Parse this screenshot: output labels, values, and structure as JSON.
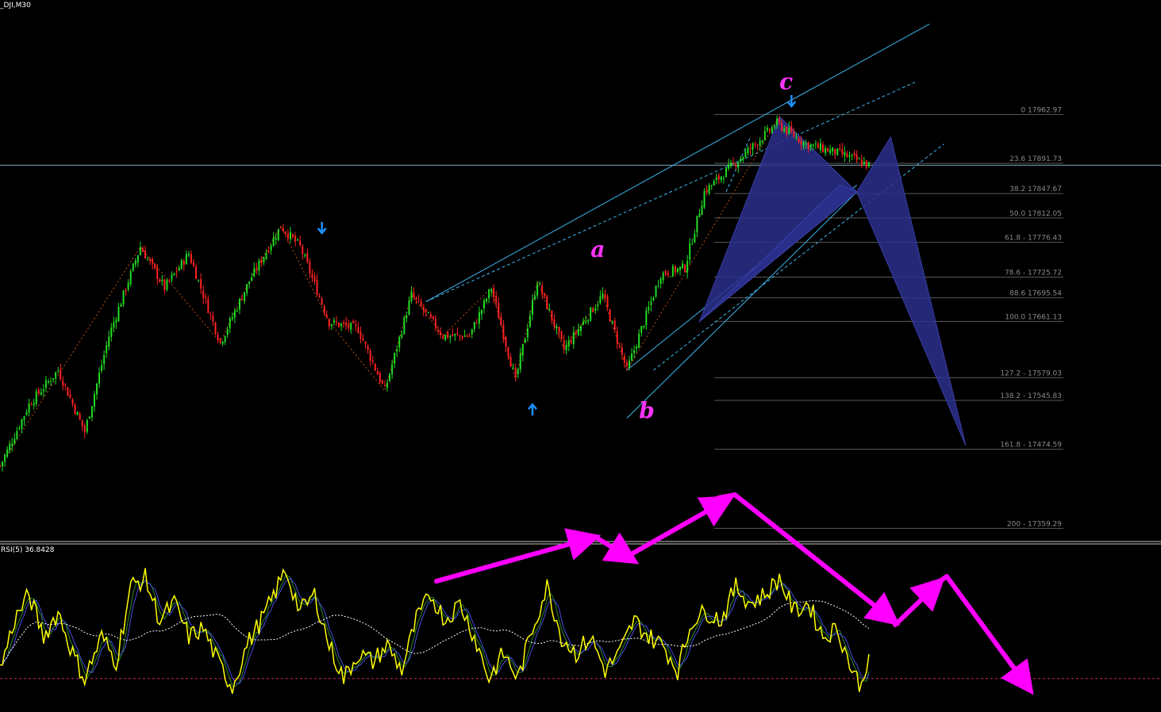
{
  "header": {
    "symbol_label": "_DJI,M30",
    "rsi_label": "RSI(5) 36.8428"
  },
  "colors": {
    "background": "#000000",
    "bull": "#22dd22",
    "bear": "#ff2222",
    "fib_line": "#5a5a5a",
    "trend": "#3fb6f0",
    "pattern_fill": "#2a2f8c",
    "wave_label": "#ff33ff",
    "rsi_line": "#ffff00",
    "rsi_ma": "#ffffff",
    "rsi_level": "#cc2266",
    "arrow": "#1e90ff"
  },
  "chart_data": [
    {
      "type": "candlestick",
      "symbol": "_DJI",
      "timeframe": "M30",
      "price_range": [
        17340,
        18130
      ],
      "current_price": 17889,
      "fib_levels": [
        {
          "level": "0",
          "price": 17962.97,
          "label": "0 17962.97"
        },
        {
          "level": "23.6",
          "price": 17891.73,
          "label": "23.6 17891.73"
        },
        {
          "level": "38.2",
          "price": 17847.67,
          "label": "38.2 17847.67"
        },
        {
          "level": "50.0",
          "price": 17812.05,
          "label": "50.0 17812.05"
        },
        {
          "level": "61.8",
          "price": 17776.43,
          "label": "61.8 - 17776.43"
        },
        {
          "level": "78.6",
          "price": 17725.72,
          "label": "78.6 - 17725.72"
        },
        {
          "level": "88.6",
          "price": 17695.54,
          "label": "88.6 17695.54"
        },
        {
          "level": "100.0",
          "price": 17661.13,
          "label": "100.0 17661.13"
        },
        {
          "level": "127.2",
          "price": 17579.03,
          "label": "127.2 - 17579.03"
        },
        {
          "level": "138.2",
          "price": 17545.83,
          "label": "138.2 - 17545.83"
        },
        {
          "level": "161.8",
          "price": 17474.59,
          "label": "161.8 -  17474.59"
        },
        {
          "level": "200",
          "price": 17359.29,
          "label": "200 - 17359.29"
        }
      ],
      "waypoints": [
        {
          "i": 0,
          "p": 17450
        },
        {
          "i": 12,
          "p": 17540
        },
        {
          "i": 24,
          "p": 17590
        },
        {
          "i": 35,
          "p": 17500
        },
        {
          "i": 45,
          "p": 17640
        },
        {
          "i": 58,
          "p": 17770
        },
        {
          "i": 68,
          "p": 17710
        },
        {
          "i": 78,
          "p": 17760
        },
        {
          "i": 91,
          "p": 17630
        },
        {
          "i": 103,
          "p": 17720
        },
        {
          "i": 116,
          "p": 17800
        },
        {
          "i": 124,
          "p": 17770
        },
        {
          "i": 136,
          "p": 17660
        },
        {
          "i": 148,
          "p": 17650
        },
        {
          "i": 159,
          "p": 17560
        },
        {
          "i": 170,
          "p": 17700
        },
        {
          "i": 183,
          "p": 17640
        },
        {
          "i": 194,
          "p": 17640
        },
        {
          "i": 203,
          "p": 17710
        },
        {
          "i": 213,
          "p": 17575
        },
        {
          "i": 222,
          "p": 17720
        },
        {
          "i": 233,
          "p": 17620
        },
        {
          "i": 249,
          "p": 17700
        },
        {
          "i": 259,
          "p": 17590
        },
        {
          "i": 273,
          "p": 17730
        },
        {
          "i": 283,
          "p": 17740
        },
        {
          "i": 291,
          "p": 17850
        },
        {
          "i": 306,
          "p": 17900
        },
        {
          "i": 321,
          "p": 17950
        },
        {
          "i": 333,
          "p": 17920
        },
        {
          "i": 348,
          "p": 17905
        },
        {
          "i": 359,
          "p": 17889
        }
      ],
      "wave_labels": [
        {
          "text": "a",
          "i": 244,
          "p": 17755
        },
        {
          "text": "b",
          "i": 264,
          "p": 17520
        },
        {
          "text": "c",
          "i": 322,
          "p": 18000
        }
      ],
      "pattern": {
        "name": "harmonic",
        "points": [
          {
            "i": 289,
            "p": 17661
          },
          {
            "i": 322,
            "p": 17960
          },
          {
            "i": 354,
            "p": 17850
          },
          {
            "i": 368,
            "p": 17930
          },
          {
            "i": 399,
            "p": 17480
          }
        ]
      }
    },
    {
      "type": "line",
      "indicator": "RSI",
      "period": 5,
      "current_value": 36.8428,
      "ylim": [
        0,
        100
      ],
      "level": 20,
      "waypoints": [
        {
          "i": 0,
          "v": 25
        },
        {
          "i": 6,
          "v": 55
        },
        {
          "i": 12,
          "v": 70
        },
        {
          "i": 18,
          "v": 45
        },
        {
          "i": 24,
          "v": 60
        },
        {
          "i": 30,
          "v": 35
        },
        {
          "i": 35,
          "v": 20
        },
        {
          "i": 42,
          "v": 45
        },
        {
          "i": 48,
          "v": 30
        },
        {
          "i": 54,
          "v": 75
        },
        {
          "i": 60,
          "v": 80
        },
        {
          "i": 66,
          "v": 55
        },
        {
          "i": 72,
          "v": 65
        },
        {
          "i": 78,
          "v": 45
        },
        {
          "i": 84,
          "v": 50
        },
        {
          "i": 90,
          "v": 30
        },
        {
          "i": 96,
          "v": 15
        },
        {
          "i": 102,
          "v": 40
        },
        {
          "i": 110,
          "v": 60
        },
        {
          "i": 118,
          "v": 85
        },
        {
          "i": 124,
          "v": 60
        },
        {
          "i": 130,
          "v": 70
        },
        {
          "i": 136,
          "v": 40
        },
        {
          "i": 142,
          "v": 20
        },
        {
          "i": 148,
          "v": 35
        },
        {
          "i": 154,
          "v": 30
        },
        {
          "i": 160,
          "v": 40
        },
        {
          "i": 166,
          "v": 25
        },
        {
          "i": 172,
          "v": 55
        },
        {
          "i": 178,
          "v": 70
        },
        {
          "i": 184,
          "v": 55
        },
        {
          "i": 190,
          "v": 65
        },
        {
          "i": 196,
          "v": 45
        },
        {
          "i": 202,
          "v": 20
        },
        {
          "i": 208,
          "v": 35
        },
        {
          "i": 214,
          "v": 20
        },
        {
          "i": 220,
          "v": 50
        },
        {
          "i": 226,
          "v": 75
        },
        {
          "i": 232,
          "v": 45
        },
        {
          "i": 238,
          "v": 35
        },
        {
          "i": 244,
          "v": 45
        },
        {
          "i": 250,
          "v": 25
        },
        {
          "i": 256,
          "v": 35
        },
        {
          "i": 262,
          "v": 55
        },
        {
          "i": 268,
          "v": 45
        },
        {
          "i": 274,
          "v": 40
        },
        {
          "i": 280,
          "v": 25
        },
        {
          "i": 286,
          "v": 55
        },
        {
          "i": 292,
          "v": 60
        },
        {
          "i": 298,
          "v": 55
        },
        {
          "i": 304,
          "v": 75
        },
        {
          "i": 310,
          "v": 65
        },
        {
          "i": 316,
          "v": 70
        },
        {
          "i": 322,
          "v": 80
        },
        {
          "i": 328,
          "v": 60
        },
        {
          "i": 334,
          "v": 65
        },
        {
          "i": 340,
          "v": 45
        },
        {
          "i": 346,
          "v": 50
        },
        {
          "i": 352,
          "v": 25
        },
        {
          "i": 356,
          "v": 15
        },
        {
          "i": 359,
          "v": 37
        }
      ]
    }
  ]
}
